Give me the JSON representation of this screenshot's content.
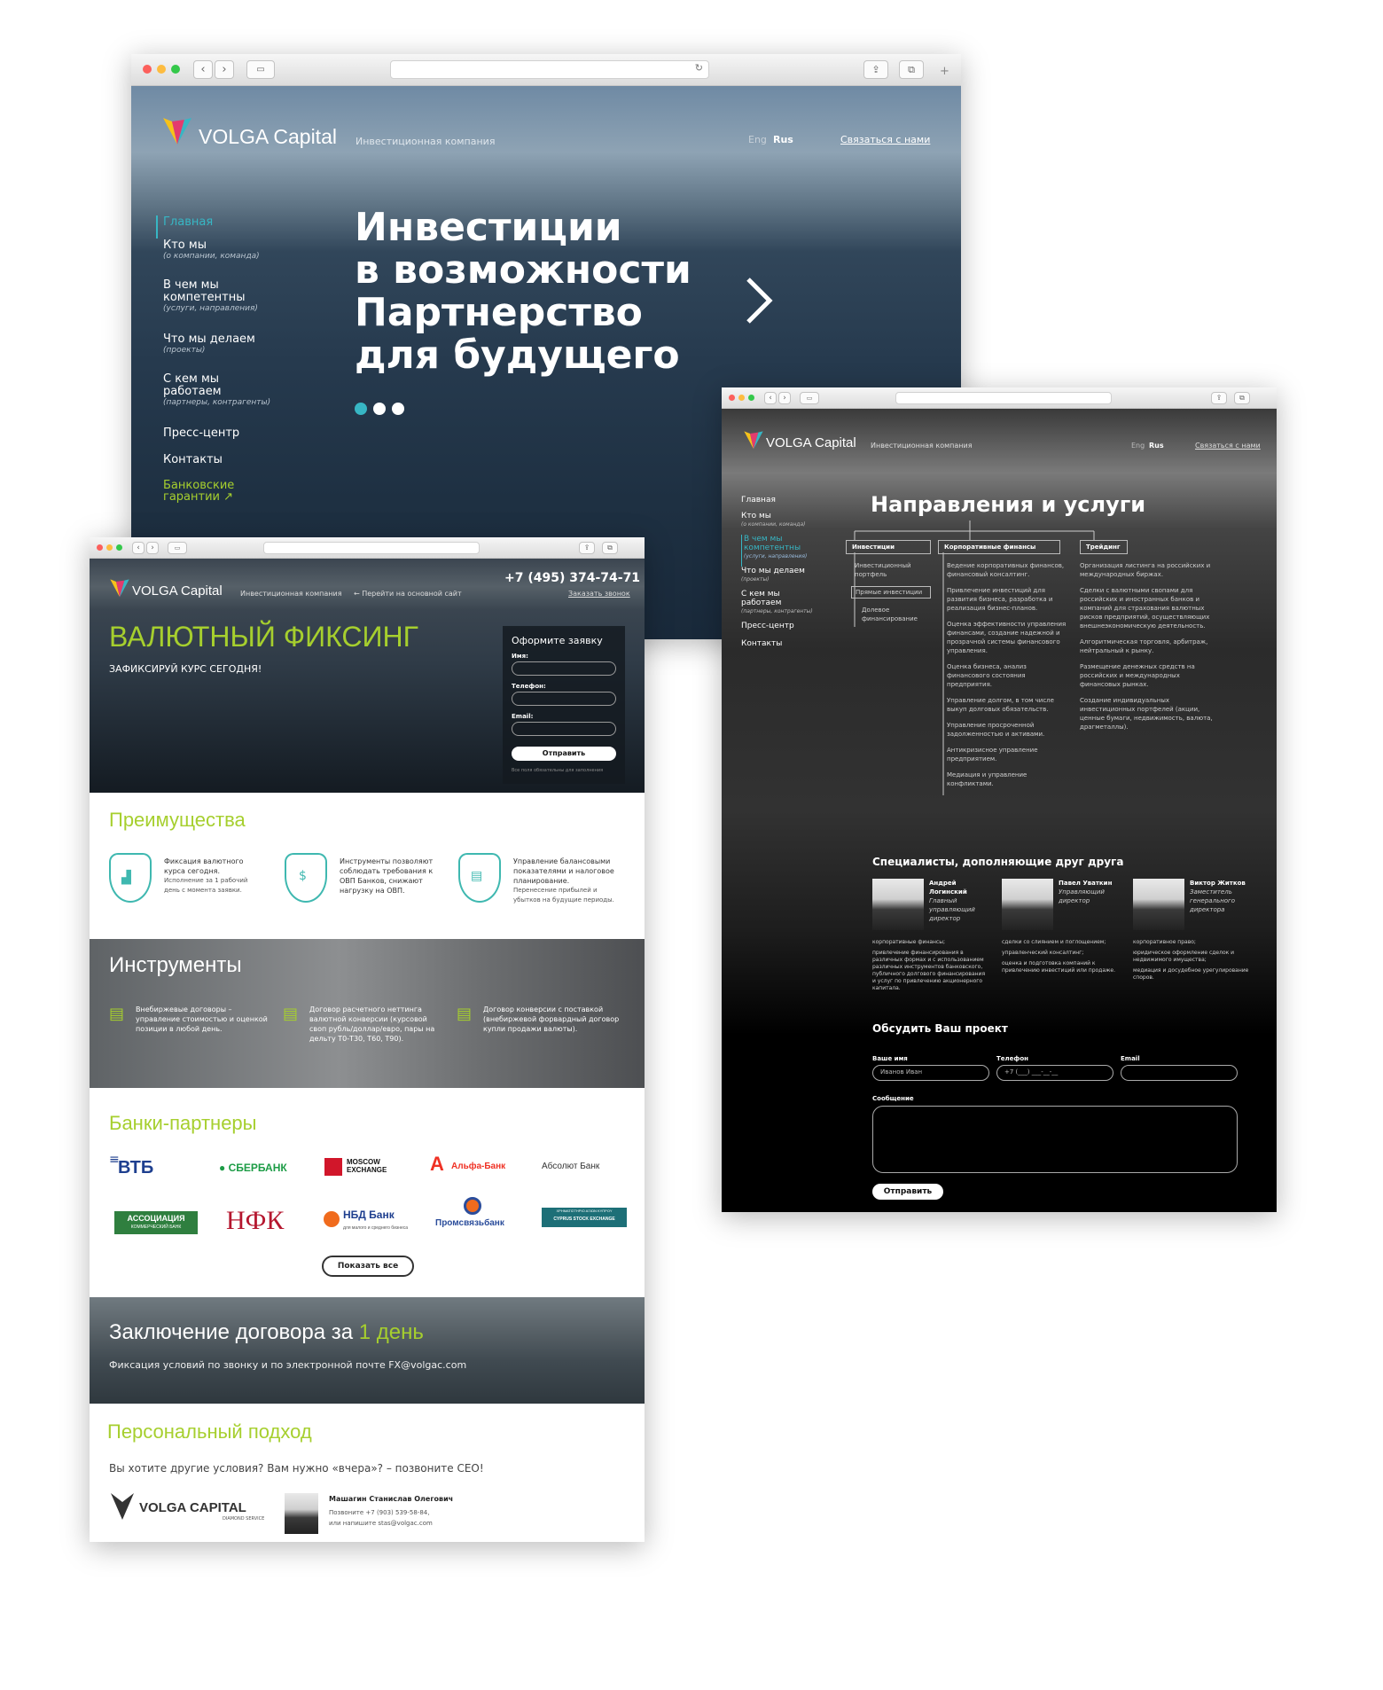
{
  "colors": {
    "lime": "#a6cf2e",
    "teal": "#37b6c4",
    "vtb_blue": "#1e3f8f",
    "sber_green": "#1d9c46",
    "moscow_red": "#d1162a",
    "alfa_red": "#ef3124",
    "nfk_red": "#b5172f",
    "nbd_orange": "#f06b1d",
    "psb_blue": "#2b4d9b",
    "cyprus_teal": "#1d6f77",
    "assoc_green": "#2f7f3f"
  },
  "w1": {
    "logo": {
      "name": "VOLGA Capital",
      "tagline": "Инвестиционная компания"
    },
    "lang": {
      "eng": "Eng",
      "rus": "Rus"
    },
    "contact": "Связаться с нами",
    "nav": [
      {
        "label": "Главная",
        "sub": ""
      },
      {
        "label": "Кто мы",
        "sub": "(о компании, команда)"
      },
      {
        "label": "В чем мы компетентны",
        "sub": "(услуги, направления)"
      },
      {
        "label": "Что мы делаем",
        "sub": "(проекты)"
      },
      {
        "label": "С кем мы работаем",
        "sub": "(партнеры, контрагенты)"
      },
      {
        "label": "Пресс-центр",
        "sub": ""
      },
      {
        "label": "Контакты",
        "sub": ""
      },
      {
        "label": "Банковские гарантии",
        "sub": ""
      }
    ],
    "hero": [
      "Инвестиции",
      "в возможности",
      "Партнерство",
      "для будущего"
    ],
    "next_icon": "chevron-right-icon"
  },
  "w2": {
    "logo": {
      "name": "VOLGA Capital",
      "tagline": "Инвестиционная компания"
    },
    "back_link": "← Перейти на основной сайт",
    "phone": "+7 (495) 374-74-71",
    "callback": "Заказать звонок",
    "hero_title": "ВАЛЮТНЫЙ ФИКСИНГ",
    "hero_sub": "ЗАФИКСИРУЙ КУРС СЕГОДНЯ!",
    "form": {
      "title": "Оформите заявку",
      "name": "Имя:",
      "phone": "Телефон:",
      "email": "Email:",
      "submit": "Отправить",
      "note": "Все поля обязательны для заполнения"
    },
    "adv_title": "Преимущества",
    "adv": [
      {
        "icon": "chart-icon",
        "text": "Фиксация валютного курса сегодня.",
        "note": "Исполнение за 1 рабочий день с момента заявки."
      },
      {
        "icon": "money-house-icon",
        "text": "Инструменты позволяют соблюдать требования к ОВП Банков, снижают нагрузку на ОВП.",
        "note": ""
      },
      {
        "icon": "balance-chart-icon",
        "text": "Управление балансовыми показателями и налоговое планирование.",
        "note": "Перенесение прибылей и убытков на будущие периоды."
      }
    ],
    "tools_title": "Инструменты",
    "tools": [
      "Внебиржевые договоры – управление стоимостью и оценкой позиции в любой день.",
      "Договор расчетного неттинга валютной конверсии (курсовой своп рубль/доллар/евро, пары на дельту Т0-Т30, Т60, Т90).",
      "Договор конверсии с поставкой (внебиржевой форвардный договор купли продажи валюты)."
    ],
    "banks_title": "Банки-партнеры",
    "banks": {
      "vtb": "ВТБ",
      "sber": "СБЕРБАНК",
      "moscow1": "MOSCOW",
      "moscow2": "EXCHANGE",
      "alfa": "Альфа-Банк",
      "absolut": "Абсолют Банк",
      "assoc1": "АССОЦИАЦИЯ",
      "assoc2": "КОММЕРЧЕСКИЙ БАНК",
      "nfk": "НФК",
      "nbd": "НБД Банк",
      "nbd_sub": "для малого и среднего бизнеса",
      "psb": "Промсвязьбанк",
      "cyprus1": "ΧΡΗΜΑΤΙΣΤΗΡΙΟ ΑΞΙΩΝ ΚΥΠΡΟΥ",
      "cyprus2": "CYPRUS STOCK EXCHANGE"
    },
    "show_all": "Показать все",
    "deal_title": "Заключение договора за",
    "deal_accent": "1 день",
    "deal_sub": "Фиксация условий по звонку и по электронной почте FX@volgac.com",
    "personal_title": "Персональный подход",
    "personal_q": "Вы хотите другие условия? Вам нужно «вчера»? – позвоните CEO!",
    "diamond_logo": "VOLGA CAPITAL",
    "diamond_sub": "DIAMOND SERVICE",
    "ceo_name": "Машагин Станислав Олегович",
    "ceo_phone": "Позвоните +7 (903) 539-58-84,",
    "ceo_mail": "или напишите stas@volgac.com"
  },
  "w3": {
    "logo": {
      "name": "VOLGA Capital",
      "tagline": "Инвестиционная компания"
    },
    "lang": {
      "eng": "Eng",
      "rus": "Rus"
    },
    "contact": "Связаться с нами",
    "nav": [
      {
        "label": "Главная",
        "sub": ""
      },
      {
        "label": "Кто мы",
        "sub": "(о компании, команда)"
      },
      {
        "label": "В чем мы компетентны",
        "sub": "(услуги, направления)"
      },
      {
        "label": "Что мы делаем",
        "sub": "(проекты)"
      },
      {
        "label": "С кем мы работаем",
        "sub": "(партнеры, контрагенты)"
      },
      {
        "label": "Пресс-центр",
        "sub": ""
      },
      {
        "label": "Контакты",
        "sub": ""
      }
    ],
    "title": "Направления и услуги",
    "col1": {
      "head": "Инвестиции",
      "items": [
        "Инвестиционный портфель",
        "Прямые инвестиции",
        "Долевое финансирование"
      ]
    },
    "col2": {
      "head": "Корпоративные финансы",
      "items": [
        "Ведение корпоративных финансов, финансовый консалтинг.",
        "Привлечение инвестиций для развития бизнеса, разработка и реализация бизнес-планов.",
        "Оценка эффективности управления финансами, создание надежной и прозрачной системы финансового управления.",
        "Оценка бизнеса, анализ финансового состояния предприятия.",
        "Управление долгом, в том числе выкуп долговых обязательств.",
        "Управление просроченной задолженностью и активами.",
        "Антикризисное управление предприятием.",
        "Медиация и управление конфликтами."
      ]
    },
    "col3": {
      "head": "Трейдинг",
      "items": [
        "Организация листинга на российских и международных биржах.",
        "Сделки с валютными свопами для российских и иностранных банков и компаний для страхования валютных рисков предприятий, осуществляющих внешнеэкономическую деятельность.",
        "Алгоритмическая торговля, арбитраж, нейтральный к рынку.",
        "Размещение денежных средств на российских и международных финансовых рынках.",
        "Создание индивидуальных инвестиционных портфелей (акции, ценные бумаги, недвижимость, валюта, драгметаллы)."
      ]
    },
    "team_title": "Специалисты, дополняющие друг друга",
    "team": [
      {
        "name": "Андрей Логинский",
        "role": "Главный управляющий директор",
        "skills": [
          "корпоративные финансы;",
          "привлечение финансирования в различных формах и с использованием различных инструментов банковского, публичного долгового финансирования и услуг по привлечению акционерного капитала."
        ]
      },
      {
        "name": "Павел Уваткин",
        "role": "Управляющий директор",
        "skills": [
          "сделки со слиянием и поглощением;",
          "управленческий консалтинг;",
          "оценка и подготовка компаний к привлечению инвестиций или продаже."
        ]
      },
      {
        "name": "Виктор Житков",
        "role": "Заместитель генерального директора",
        "skills": [
          "корпоративное право;",
          "юридическое оформление сделок и недвижимого имущества;",
          "медиация и досудебное урегулирование споров."
        ]
      }
    ],
    "discuss_title": "Обсудить Ваш проект",
    "form": {
      "name_label": "Ваше имя",
      "name_ph": "Иванов Иван",
      "phone_label": "Телефон",
      "phone_ph": "+7 (___) ___-__-__",
      "email_label": "Email",
      "msg_label": "Сообщение",
      "submit": "Отправить"
    }
  }
}
